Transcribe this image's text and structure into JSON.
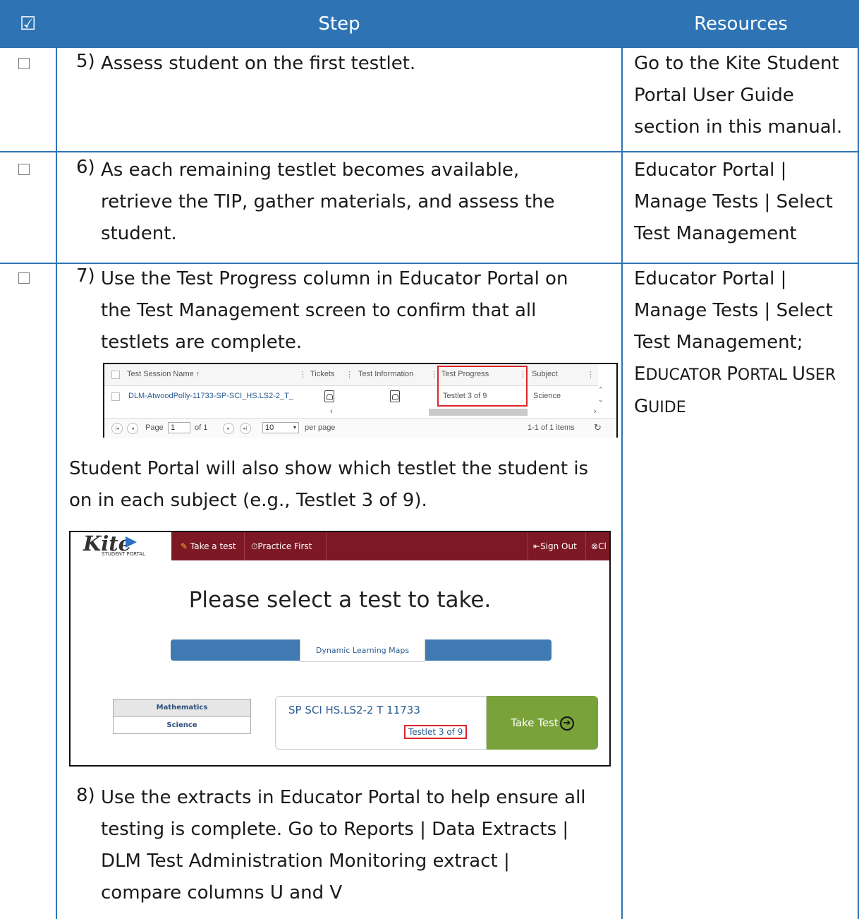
{
  "header": {
    "check_symbol": "☑",
    "step": "Step",
    "resources": "Resources"
  },
  "rows": [
    {
      "num": "5)",
      "lines": [
        "Assess student on the first testlet."
      ],
      "resource_lines": [
        "Go to the Kite Student",
        "Portal User Guide",
        "section in this manual."
      ]
    },
    {
      "num": "6)",
      "lines": [
        "As each remaining testlet becomes available,",
        "retrieve the TIP, gather materials, and assess the",
        "student."
      ],
      "resource_lines": [
        "Educator Portal |",
        "Manage Tests | Select",
        "Test Management"
      ]
    },
    {
      "num": "7)",
      "lines": [
        "Use the Test Progress column in Educator Portal on",
        "the Test Management screen to confirm that all",
        "testlets are complete."
      ],
      "resource_lines": [
        "Educator Portal |",
        "Manage Tests | Select",
        "Test Management;"
      ],
      "resource_sc_1": {
        "big": "E",
        "small": "DUCATOR ",
        "big2": "P",
        "small2": "ORTAL ",
        "big3": "U",
        "small3": "SER"
      },
      "resource_sc_2": {
        "big": "G",
        "small": "UIDE"
      },
      "after_lines": [
        "Student Portal will also show which testlet the student is",
        "on in each subject (e.g., Testlet 3 of 9)."
      ]
    },
    {
      "num": "8)",
      "lines": [
        "Use the extracts in Educator Portal to help ensure all",
        "testing is complete. Go to Reports | Data Extracts |",
        "DLM Test Administration Monitoring extract |",
        "compare columns U and V"
      ]
    }
  ],
  "test_management": {
    "columns": [
      "Test Session Name ↑",
      "Tickets",
      "Test Information",
      "Test Progress",
      "Subject"
    ],
    "row": {
      "name": "DLM-AtwoodPolly-11733-SP-SCI_HS.LS2-2_T_",
      "progress": "Testlet 3 of 9",
      "subject": "Science"
    },
    "pager": {
      "page_label": "Page",
      "page": "1",
      "of": "of 1",
      "per_page_value": "10",
      "per_page": "per page",
      "items": "1-1 of 1 items"
    }
  },
  "student_portal": {
    "logo": "Kite",
    "logo_sub": "STUDENT PORTAL",
    "nav": {
      "take_test": "Take a test",
      "practice": "Practice First",
      "sign_out": "Sign Out",
      "close": "Cl"
    },
    "title": "Please select a test to take.",
    "program_tab": "Dynamic Learning Maps",
    "subjects": [
      "Mathematics",
      "Science"
    ],
    "test_name": "SP SCI HS.LS2-2 T 11733",
    "testlet": "Testlet 3 of 9",
    "take_button": "Take Test"
  }
}
